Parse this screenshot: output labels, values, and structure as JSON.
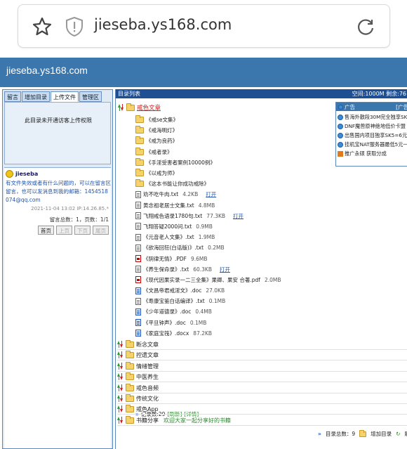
{
  "browser": {
    "url": "jieseba.ys168.com"
  },
  "site": {
    "title": "jieseba.ys168.com"
  },
  "left": {
    "tabs": [
      "留言",
      "增加目录",
      "上传文件",
      "管理区"
    ],
    "upload_message": "此目录未开通访客上传权限",
    "message": {
      "user": "jieseba",
      "text": "有文件失效或者有什么问题的，可以在留言区留言，也可以发消息到我的邮箱：1454518074@qq.com",
      "time": "2021-11-04 13:02 IP:14.26.85.*",
      "count": "留言总数：1，页数：1/1"
    },
    "pager": [
      "首页",
      "上页",
      "下页",
      "尾页"
    ]
  },
  "right": {
    "header_left": "目录列表",
    "header_right": "空间:1000M 剩余:76",
    "main_folder": "戒色文章",
    "items": [
      {
        "type": "folder",
        "name": "《戒se文集》",
        "size": "",
        "op": ""
      },
      {
        "type": "folder",
        "name": "《戒海明灯》",
        "size": "",
        "op": ""
      },
      {
        "type": "folder",
        "name": "《戒为良药》",
        "size": "",
        "op": ""
      },
      {
        "type": "folder",
        "name": "《戒者录》",
        "size": "",
        "op": ""
      },
      {
        "type": "folder",
        "name": "《手淫受害者案例10000例》",
        "size": "",
        "op": ""
      },
      {
        "type": "folder",
        "name": "《以戒为师》",
        "size": "",
        "op": ""
      },
      {
        "type": "folder",
        "name": "《这本书能让你成功戒除》",
        "size": "",
        "op": ""
      },
      {
        "type": "txt",
        "name": "劝不吃牛肉.txt",
        "size": "4.2KB",
        "op": "打开"
      },
      {
        "type": "txt",
        "name": "黄念祖老居士文集.txt",
        "size": "4.8MB",
        "op": ""
      },
      {
        "type": "txt",
        "name": "飞翔戒色语录1780句.txt",
        "size": "77.3KB",
        "op": "打开"
      },
      {
        "type": "txt",
        "name": "飞翔答疑2000问.txt",
        "size": "0.9MB",
        "op": ""
      },
      {
        "type": "txt",
        "name": "《元音老人文集》.txt",
        "size": "1.9MB",
        "op": ""
      },
      {
        "type": "txt",
        "name": "《欲海回狂(白话版)》.txt",
        "size": "0.2MB",
        "op": ""
      },
      {
        "type": "pdf",
        "name": "《阴律无情》.PDF",
        "size": "9.6MB",
        "op": ""
      },
      {
        "type": "txt",
        "name": "《养生保命录》.txt",
        "size": "60.3KB",
        "op": "打开"
      },
      {
        "type": "pdf",
        "name": "《现代因果实录一二三全集》果卿、果安 合著.pdf",
        "size": "2.0MB",
        "op": ""
      },
      {
        "type": "doc",
        "name": "《文昌帝君戒淫文》.doc",
        "size": "27.0KB",
        "op": ""
      },
      {
        "type": "txt",
        "name": "《寿康宝鉴白话编译》.txt",
        "size": "0.1MB",
        "op": ""
      },
      {
        "type": "doc",
        "name": "《少年道德录》.doc",
        "size": "0.4MB",
        "op": ""
      },
      {
        "type": "doc",
        "name": "《平旦钟声》.doc",
        "size": "0.1MB",
        "op": ""
      },
      {
        "type": "doc",
        "name": "《家庭宝筏》.docx",
        "size": "87.2KB",
        "op": ""
      }
    ],
    "records": {
      "label": "记录数:29",
      "refresh": "[刷新]",
      "detail": "[详情]"
    },
    "categories": [
      {
        "name": "断念文章",
        "note": ""
      },
      {
        "name": "控遗文章",
        "note": ""
      },
      {
        "name": "情绪管理",
        "note": ""
      },
      {
        "name": "中医养生",
        "note": ""
      },
      {
        "name": "戒色音频",
        "note": ""
      },
      {
        "name": "传统文化",
        "note": ""
      },
      {
        "name": "戒色App",
        "note": ""
      },
      {
        "name": "书籍分享",
        "note": "欢迎大家一起分享好的书籍"
      }
    ],
    "footer": {
      "count": "目录总数：9",
      "add": "增加目录",
      "refresh": "刷新"
    },
    "ad": {
      "title": "广告",
      "recruit": "[广告招商]",
      "items": [
        "售海外散段30M完全独享SK5",
        "DNF魔兽原神绝地低价卡盟",
        "出售国内项目独享SK5=6元",
        "挂机宝NAT服务器最低5元一",
        "推广永硕 获取分成"
      ]
    }
  }
}
